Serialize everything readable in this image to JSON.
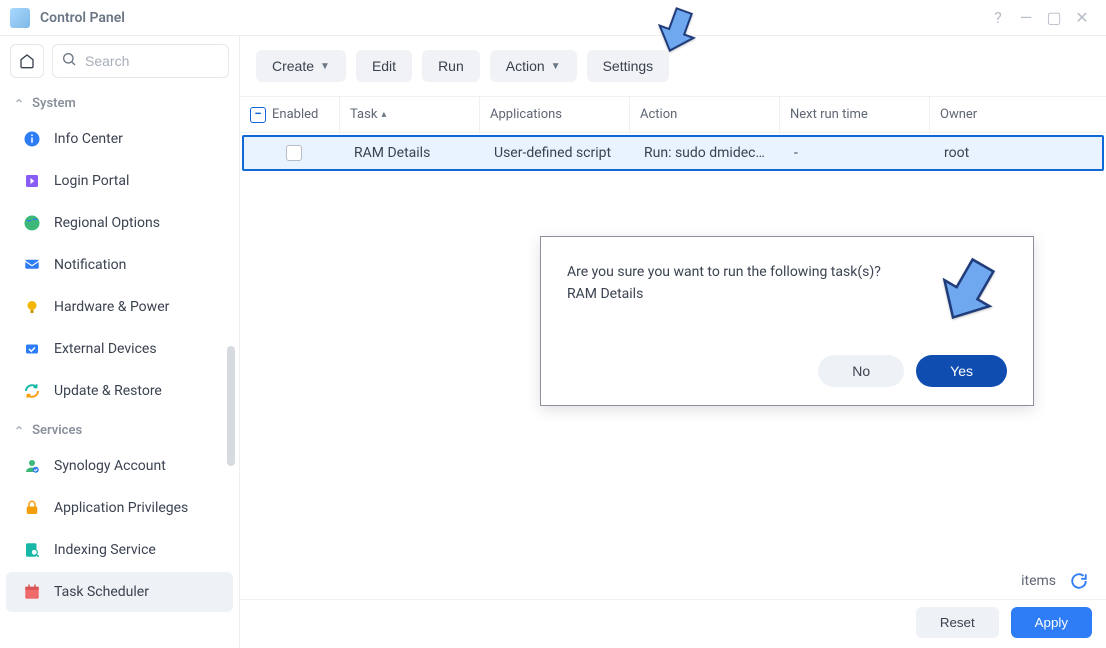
{
  "titlebar": {
    "title": "Control Panel"
  },
  "search": {
    "placeholder": "Search"
  },
  "sections": {
    "system": {
      "label": "System",
      "items": [
        {
          "label": "Info Center"
        },
        {
          "label": "Login Portal"
        },
        {
          "label": "Regional Options"
        },
        {
          "label": "Notification"
        },
        {
          "label": "Hardware & Power"
        },
        {
          "label": "External Devices"
        },
        {
          "label": "Update & Restore"
        }
      ]
    },
    "services": {
      "label": "Services",
      "items": [
        {
          "label": "Synology Account"
        },
        {
          "label": "Application Privileges"
        },
        {
          "label": "Indexing Service"
        },
        {
          "label": "Task Scheduler"
        }
      ]
    }
  },
  "toolbar": {
    "create": "Create",
    "edit": "Edit",
    "run": "Run",
    "action": "Action",
    "settings": "Settings"
  },
  "table": {
    "headers": {
      "enabled": "Enabled",
      "task": "Task",
      "applications": "Applications",
      "action": "Action",
      "next_run": "Next run time",
      "owner": "Owner"
    },
    "rows": [
      {
        "task": "RAM Details",
        "applications": "User-defined script",
        "action": "Run: sudo dmidec…",
        "next_run": "-",
        "owner": "root"
      }
    ]
  },
  "dialog": {
    "message": "Are you sure you want to run the following task(s)?",
    "detail": "RAM Details",
    "no": "No",
    "yes": "Yes"
  },
  "footer": {
    "items": "items",
    "reset": "Reset",
    "apply": "Apply"
  }
}
